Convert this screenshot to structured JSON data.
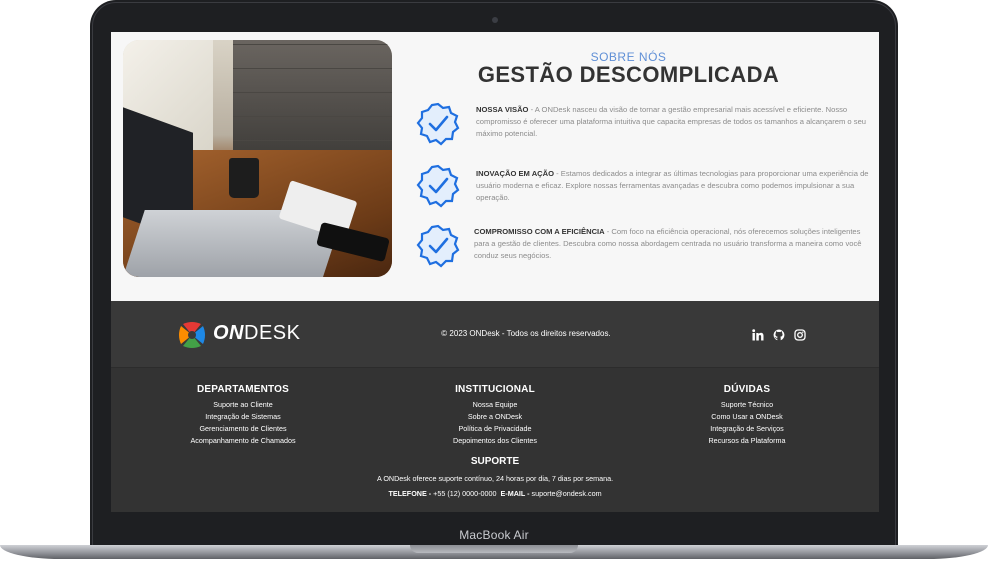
{
  "device": {
    "label": "MacBook Air"
  },
  "about": {
    "eyebrow": "SOBRE NÓS",
    "title": "GESTÃO DESCOMPLICADA",
    "features": [
      {
        "title": "NOSSA VISÃO",
        "text": " - A ONDesk nasceu da visão de tornar a gestão empresarial mais acessível e eficiente. Nosso compromisso é oferecer uma plataforma intuitiva que capacita empresas de todos os tamanhos a alcançarem o seu máximo potencial."
      },
      {
        "title": "INOVAÇÃO EM AÇÃO",
        "text": " - Estamos dedicados a integrar as últimas tecnologias para proporcionar uma experiência de usuário moderna e eficaz. Explore nossas ferramentas avançadas e descubra como podemos impulsionar a sua operação."
      },
      {
        "title": "COMPROMISSO COM A EFICIÊNCIA",
        "text": " - Com foco na eficiência operacional, nós oferecemos soluções inteligentes para a gestão de clientes. Descubra como nossa abordagem centrada no usuário transforma a maneira como você conduz seus negócios."
      }
    ],
    "badge_icon": "verified-check-badge-icon",
    "accent_color": "#1f6fe0"
  },
  "footer": {
    "logo": {
      "on": "ON",
      "desk": "DESK"
    },
    "copyright": "© 2023 ONDesk - Todos os direitos reservados.",
    "social_icons": [
      "linkedin-icon",
      "github-icon",
      "instagram-icon"
    ],
    "columns": [
      {
        "title": "DEPARTAMENTOS",
        "items": [
          "Suporte ao Cliente",
          "Integração de Sistemas",
          "Gerenciamento de Clientes",
          "Acompanhamento de Chamados"
        ]
      },
      {
        "title": "INSTITUCIONAL",
        "items": [
          "Nossa Equipe",
          "Sobre a ONDesk",
          "Política de Privacidade",
          "Depoimentos dos Clientes"
        ]
      },
      {
        "title": "DÚVIDAS",
        "items": [
          "Suporte Técnico",
          "Como Usar a ONDesk",
          "Integração de Serviços",
          "Recursos da Plataforma"
        ]
      }
    ],
    "support": {
      "title": "SUPORTE",
      "text": "A ONDesk oferece suporte contínuo, 24 horas por dia, 7 dias por semana.",
      "phone_label": "TELEFONE -",
      "phone": "+55 (12) 0000-0000",
      "email_label": "E-MAIL -",
      "email": "suporte@ondesk.com"
    }
  }
}
